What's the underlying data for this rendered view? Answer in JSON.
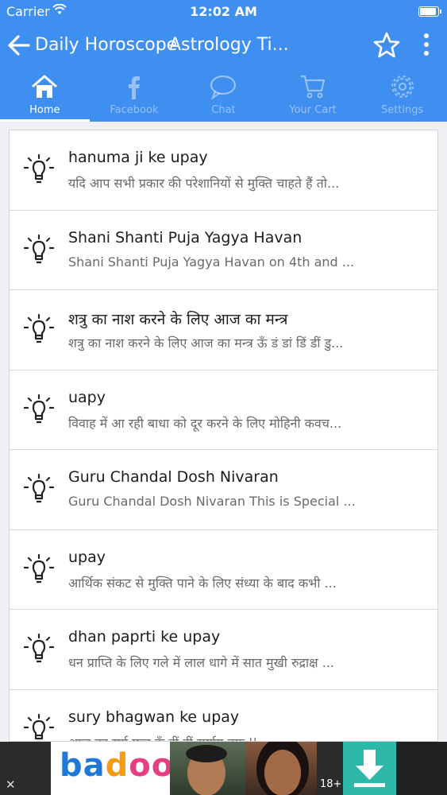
{
  "status": {
    "carrier": "Carrier",
    "time": "12:02 AM"
  },
  "header": {
    "title_part1": "Daily Horoscope",
    "title_part2": "Astrology Ti..."
  },
  "tabs": [
    {
      "label": "Home",
      "icon": "home-icon"
    },
    {
      "label": "Facebook",
      "icon": "facebook-icon"
    },
    {
      "label": "Chat",
      "icon": "chat-icon"
    },
    {
      "label": "Your Cart",
      "icon": "cart-icon"
    },
    {
      "label": "Settings",
      "icon": "gear-icon"
    }
  ],
  "items": [
    {
      "title": "hanuma ji ke upay",
      "subtitle": "यदि आप सभी प्रकार की परेशानियों से मुक्ति चाहते हैं तो..."
    },
    {
      "title": "Shani Shanti Puja Yagya Havan",
      "subtitle": " Shani Shanti Puja Yagya Havan on 4th and ..."
    },
    {
      "title": "शत्रु का नाश करने के लिए आज का मन्त्र",
      "subtitle": "शत्रु का नाश करने के लिए आज का मन्त्र ऊँ डं डां डिं डीं डु..."
    },
    {
      "title": "uapy",
      "subtitle": "विवाह में आ रही बाधा को दूर करने के लिए मोहिनी कवच..."
    },
    {
      "title": "Guru Chandal Dosh Nivaran",
      "subtitle": "Guru Chandal Dosh Nivaran This is Special ..."
    },
    {
      "title": "upay",
      "subtitle": "आर्थिक संकट से मुक्ति पाने के लिए संध्या के बाद कभी ..."
    },
    {
      "title": "dhan paprti ke upay",
      "subtitle": "धन प्राप्ति के लिए गले में लाल धागे में सात मुखी रुद्राक्ष ..."
    },
    {
      "title": "sury bhagwan ke upay",
      "subtitle": "आज का सूर्य मन्त्र ऊँ ह्रीं ह्रीं सूर्याय नमः ||"
    }
  ],
  "ad": {
    "brand_part1": "ba",
    "brand_part2": "d",
    "brand_part3": "oo",
    "age_tag": "18+",
    "close_label": "✕"
  },
  "colors": {
    "primary": "#3f8ff0",
    "inactive_tab": "rgba(255,255,255,0.45)"
  }
}
